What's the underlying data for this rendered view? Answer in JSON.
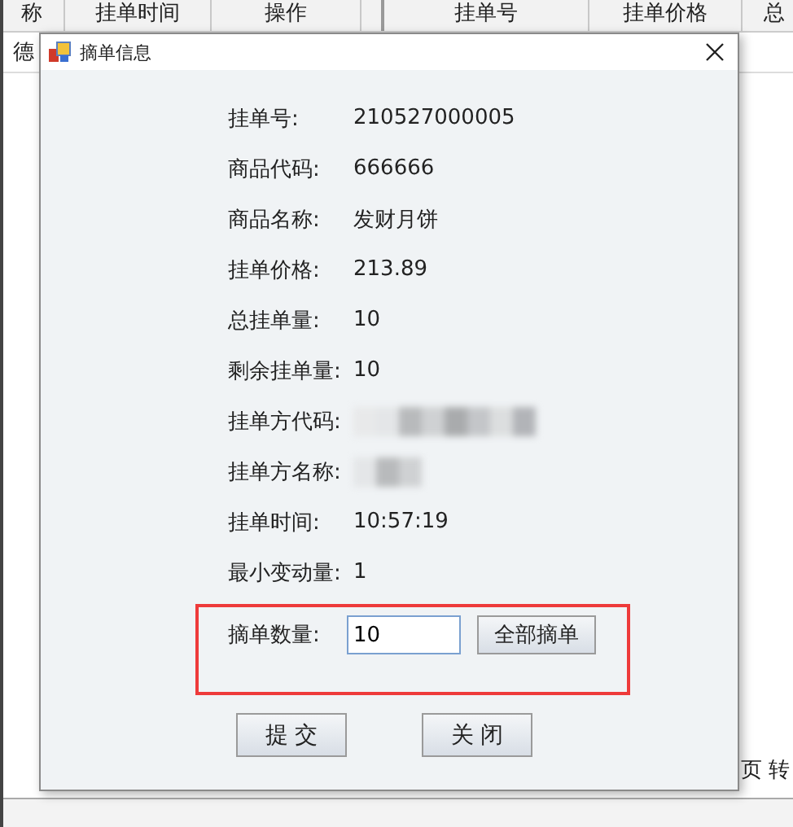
{
  "background_table": {
    "columns": [
      "称",
      "挂单时间",
      "操作",
      "",
      "挂单号",
      "挂单价格",
      "总"
    ],
    "row_text": "德",
    "pager_text": "页 转"
  },
  "dialog": {
    "title": "摘单信息",
    "fields": [
      {
        "label": "挂单号:",
        "value": "210527000005"
      },
      {
        "label": "商品代码:",
        "value": "666666"
      },
      {
        "label": "商品名称:",
        "value": "发财月饼"
      },
      {
        "label": "挂单价格:",
        "value": "213.89"
      },
      {
        "label": "总挂单量:",
        "value": "10"
      },
      {
        "label": "剩余挂单量:",
        "value": "10"
      },
      {
        "label": "挂单方代码:",
        "redacted": true
      },
      {
        "label": "挂单方名称:",
        "redacted": true
      },
      {
        "label": "挂单时间:",
        "value": "10:57:19"
      },
      {
        "label": "最小变动量:",
        "value": "1"
      }
    ],
    "quantity": {
      "label": "摘单数量:",
      "value": "10",
      "button": "全部摘单",
      "highlighted": true
    },
    "buttons": [
      "提 交",
      "关 闭"
    ]
  }
}
